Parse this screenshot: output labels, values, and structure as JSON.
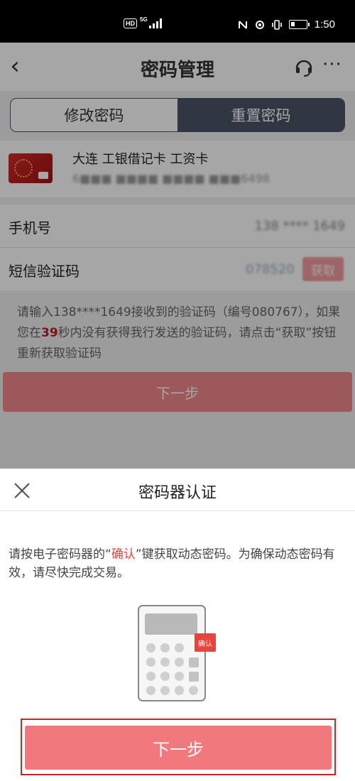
{
  "status_bar": {
    "hd_badge": "HD",
    "network": "5G",
    "time": "1:50"
  },
  "nav": {
    "back_glyph": "‹",
    "title": "密码管理",
    "more_glyph": "···"
  },
  "tabs": [
    {
      "label": "修改密码",
      "active": false
    },
    {
      "label": "重置密码",
      "active": true
    }
  ],
  "card": {
    "name": "大连 工银借记卡 工资卡",
    "number_masked": "6■■■ ■■■■ ■■■■ ■■■6498"
  },
  "phone_field": {
    "label": "手机号",
    "value_masked": "138 **** 1649"
  },
  "sms_field": {
    "label": "短信验证码",
    "value_masked": "078520",
    "get_button": "获取"
  },
  "hint": {
    "part1": "请输入138****1649接收到的验证码（编号080767），如果您在",
    "seconds": "39",
    "part2": "秒内没有获得我行发送的验证码，请点击“获取”按钮重新获取验证码"
  },
  "base_next_button": "下一步",
  "dialog": {
    "title": "密码器认证",
    "desc_prefix": "请按电子密码器的“",
    "desc_highlight": "确认",
    "desc_suffix": "”键获取动态密码。为确保动态密码有效，请尽快完成交易。",
    "token_tag": "确认",
    "next_button": "下一步"
  },
  "colors": {
    "primary_red": "#f1787c",
    "highlight_red": "#e6453e",
    "tab_active": "#4a5466"
  }
}
